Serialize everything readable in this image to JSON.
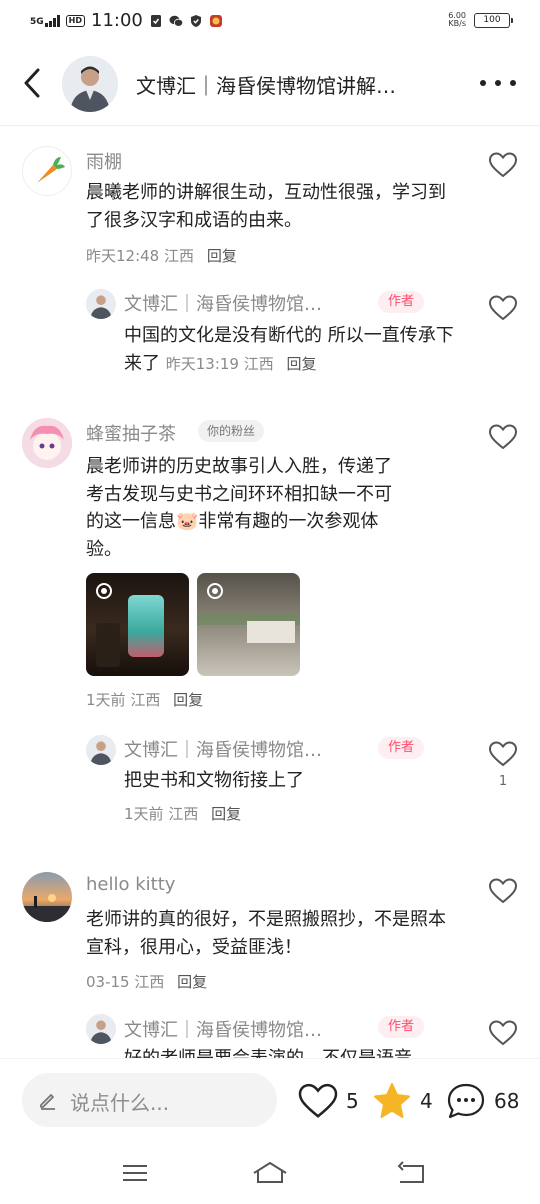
{
  "status_bar": {
    "network": "5G",
    "hd": "HD",
    "time": "11:00",
    "net_speed_value": "6.00",
    "net_speed_unit": "KB/s",
    "battery": "100"
  },
  "header": {
    "title": "文博汇｜海昏侯博物馆讲解…",
    "back_icon": "chevron-left-icon",
    "more_icon": "more-horizontal-icon"
  },
  "comments": [
    {
      "user": "雨棚",
      "text": "晨曦老师的讲解很生动，互动性很强，学习到了很多汉字和成语的由来。",
      "time": "昨天12:48",
      "location": "江西",
      "reply_label": "回复",
      "reply": {
        "user": "文博汇｜海昏侯博物馆…",
        "badge": "作者",
        "text": "中国的文化是没有断代的 所以一直传承下来了",
        "time": "昨天13:19",
        "location": "江西",
        "reply_label": "回复"
      }
    },
    {
      "user": "蜂蜜抽子茶",
      "badge": "你的粉丝",
      "text_line1": "晨老师讲的历史故事引人入胜，传递了",
      "text_line2": "考古发现与史书之间环环相扣缺一不可",
      "text_line3a": "的这一信息",
      "text_emoji": "🐷",
      "text_line3b": "非常有趣的一次参观体",
      "text_line4": "验。",
      "time": "1天前",
      "location": "江西",
      "reply_label": "回复",
      "reply": {
        "user": "文博汇｜海昏侯博物馆…",
        "badge": "作者",
        "text": "把史书和文物衔接上了",
        "time": "1天前",
        "location": "江西",
        "reply_label": "回复",
        "likes": "1"
      }
    },
    {
      "user": "hello kitty",
      "text": "老师讲的真的很好，不是照搬照抄，不是照本宣科，很用心，受益匪浅！",
      "time": "03-15",
      "location": "江西",
      "reply_label": "回复",
      "reply": {
        "user": "文博汇｜海昏侯博物馆…",
        "badge": "作者",
        "text": "好的老师是要会表演的，不仅是语音"
      }
    }
  ],
  "bottom_bar": {
    "placeholder": "说点什么...",
    "likes": "5",
    "favorites": "4",
    "comments": "68"
  },
  "colors": {
    "author_badge": "#ff4d6d",
    "star": "#f6b526",
    "muted_text": "#8a8a8a"
  }
}
